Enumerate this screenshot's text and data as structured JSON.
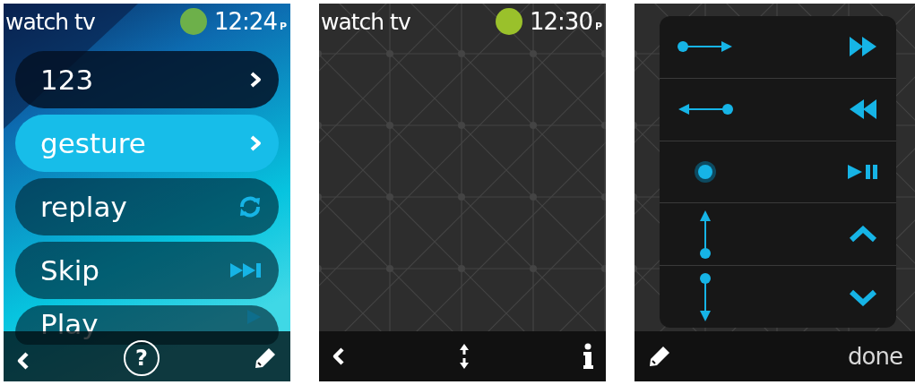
{
  "screens": [
    {
      "kind": "menu",
      "header": {
        "title": "watch tv",
        "color": "#6db04a",
        "time": "12:24",
        "meridiem": "P"
      },
      "items": [
        {
          "label": "123",
          "kind": "chevron",
          "selected": false
        },
        {
          "label": "gesture",
          "kind": "chevron",
          "selected": true
        },
        {
          "label": "replay",
          "kind": "replay",
          "selected": false
        },
        {
          "label": "Skip",
          "kind": "skip",
          "selected": false
        },
        {
          "label": "Play",
          "kind": "play",
          "selected": false
        }
      ],
      "toolbar": [
        {
          "kind": "back"
        },
        {
          "kind": "help",
          "label": "?"
        },
        {
          "kind": "edit"
        }
      ]
    },
    {
      "kind": "pad",
      "header": {
        "title": "watch tv",
        "color": "#9ac12b",
        "time": "12:30",
        "meridiem": "P"
      },
      "toolbar": [
        {
          "kind": "back"
        },
        {
          "kind": "scroll"
        },
        {
          "kind": "info"
        }
      ]
    },
    {
      "kind": "map",
      "mappings": [
        {
          "kind": "swipe-right"
        },
        {
          "kind": "swipe-left"
        },
        {
          "kind": "tap"
        },
        {
          "kind": "swipe-up"
        },
        {
          "kind": "swipe-down"
        }
      ],
      "toolbar": [
        {
          "kind": "edit"
        },
        {
          "kind": "done",
          "label": "done"
        }
      ]
    }
  ]
}
